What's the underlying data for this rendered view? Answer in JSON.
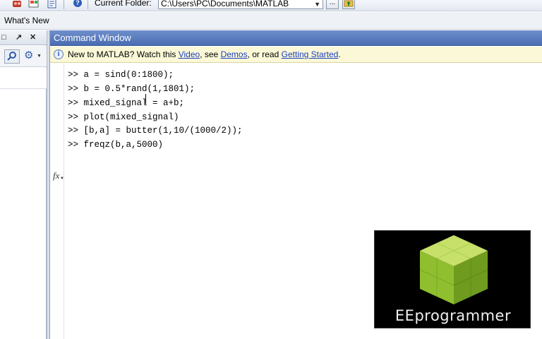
{
  "toolbar": {
    "current_folder_label": "Current Folder:",
    "current_folder_path": "C:\\Users\\PC\\Documents\\MATLAB",
    "browse_label": "...",
    "icons": [
      "simulink-icon",
      "guide-icon",
      "profiler-icon",
      "help-icon",
      "folder-up-icon"
    ]
  },
  "shortcuts": {
    "whats_new": "What's New"
  },
  "left_panel": {
    "buttons": [
      "□",
      "↗",
      "✕"
    ]
  },
  "command_window": {
    "title": "Command Window",
    "info": {
      "prefix": "New to MATLAB? Watch this ",
      "video_link": "Video",
      "sep1": ", see ",
      "demos_link": "Demos",
      "sep2": ", or read ",
      "getting_started_link": "Getting Started",
      "suffix": "."
    },
    "lines": [
      ">> a = sind(0:1800);",
      ">> b = 0.5*rand(1,1801);",
      ">> mixed_signal = a+b;",
      ">> plot(mixed_signal)",
      ">> [b,a] = butter(1,10/(1000/2));",
      ">> freqz(b,a,5000)"
    ],
    "fx_label": "fx"
  },
  "logo": {
    "text": "EEprogrammer"
  },
  "colors": {
    "title_bar": "#5677bd",
    "info_bar": "#fbf8d8",
    "link": "#1a3fbf",
    "cube_green": "#9bc53d"
  }
}
